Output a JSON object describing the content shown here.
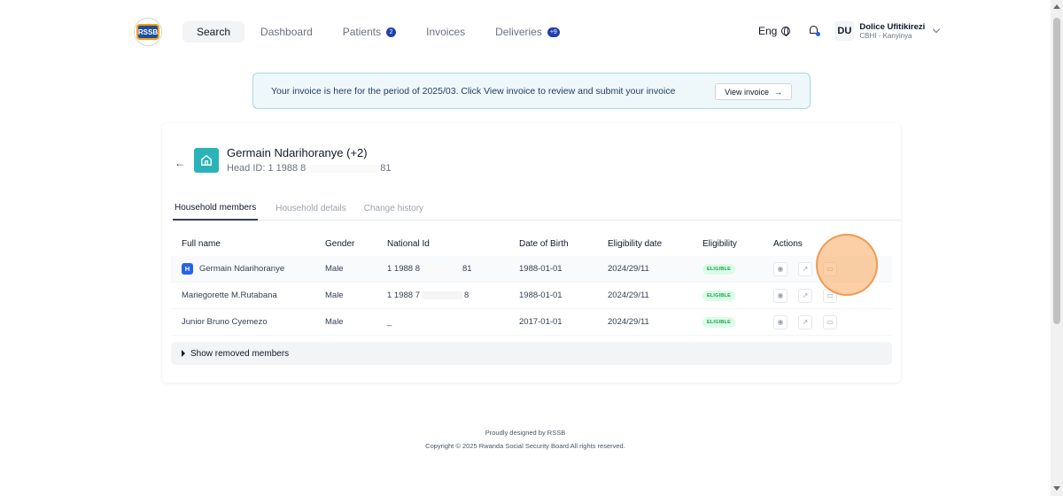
{
  "logo": {
    "text": "RSSB"
  },
  "nav": {
    "items": [
      {
        "label": "Search",
        "active": true
      },
      {
        "label": "Dashboard"
      },
      {
        "label": "Patients",
        "badge": "2"
      },
      {
        "label": "Invoices"
      },
      {
        "label": "Deliveries",
        "badge": "+9"
      }
    ]
  },
  "header": {
    "language": "Eng",
    "avatar_initials": "DU",
    "user_name": "Dolice Ufitikirezi",
    "user_role": "CBHI - Kanyinya"
  },
  "banner": {
    "text": "Your invoice is here for the period of 2025/03. Click View invoice to review and submit your invoice",
    "button_label": "View invoice",
    "button_arrow": "→"
  },
  "household": {
    "back_icon": "←",
    "name": "Germain Ndarihoranye (+2)",
    "head_id_prefix": "Head ID: 1 1988 8",
    "head_id_suffix": "81"
  },
  "tabs": [
    "Household members",
    "Household details",
    "Change history"
  ],
  "table": {
    "columns": [
      "Full name",
      "Gender",
      "National Id",
      "Date of Birth",
      "Eligibility date",
      "Eligibility",
      "Actions"
    ],
    "rows": [
      {
        "head_badge": "H",
        "name": "Germain Ndarihoranye",
        "gender": "Male",
        "nid_prefix": "1 1988 8",
        "nid_suffix": "81",
        "dob": "1988-01-01",
        "elig_date": "2024/29/11",
        "eligibility": "ELIGIBLE"
      },
      {
        "name": "Mariegorette M.Rutabana",
        "gender": "Male",
        "nid_prefix": "1 1988 7",
        "nid_suffix": "8",
        "dob": "1988-01-01",
        "elig_date": "2024/29/11",
        "eligibility": "ELIGIBLE"
      },
      {
        "name": "Junior Bruno Cyemezo",
        "gender": "Male",
        "nid": "_",
        "dob": "2017-01-01",
        "elig_date": "2024/29/11",
        "eligibility": "ELIGIBLE"
      }
    ],
    "action_icons": [
      "eye-icon",
      "arrow-up-right-icon",
      "folder-icon"
    ]
  },
  "removed_members": {
    "label": "Show removed members"
  },
  "footer": {
    "line1": "Proudly designed by RSSB",
    "line2": "Copyright © 2025 Rwanda Social Security Board All rights reserved."
  },
  "colors": {
    "accent": "#2bb3b9",
    "badge": "#1e40af",
    "eligible_text": "#16a34a",
    "eligible_bg": "#dcfce7",
    "highlight": "#f9a85c"
  }
}
